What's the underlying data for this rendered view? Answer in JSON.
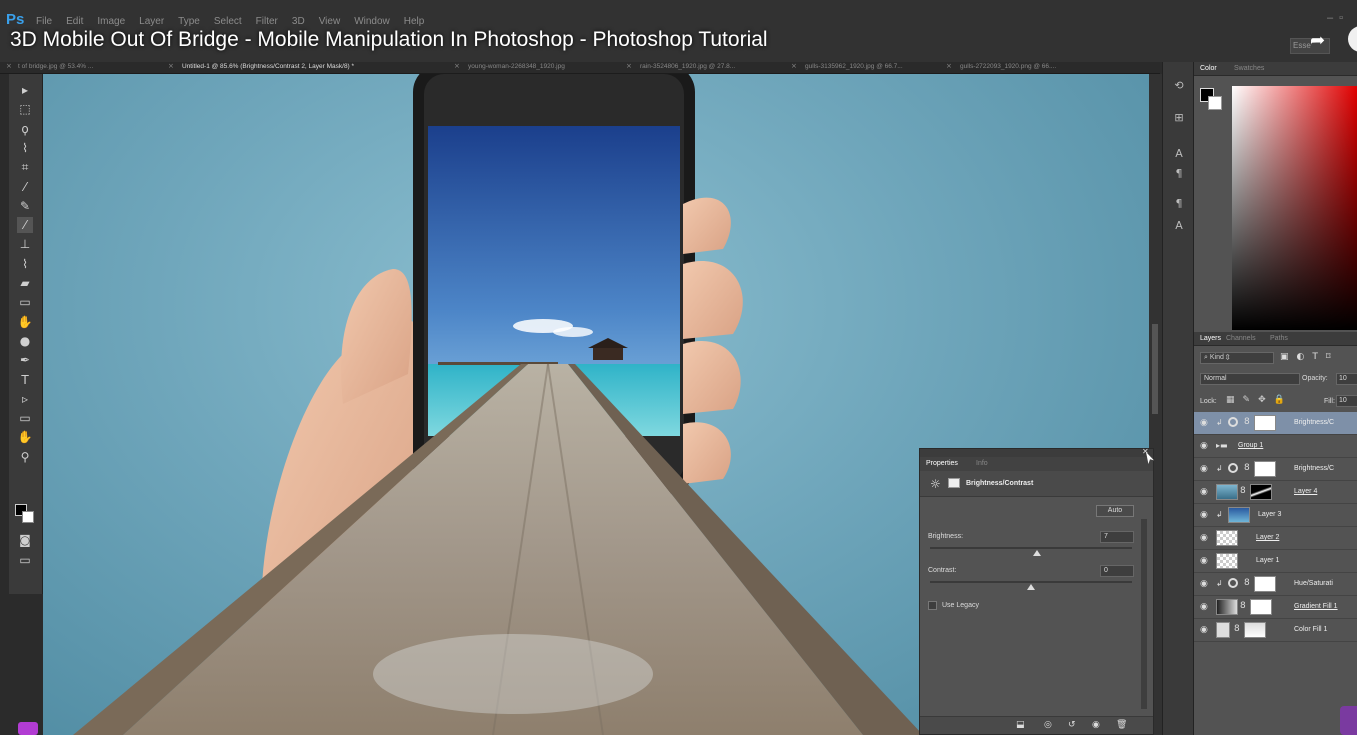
{
  "app": {
    "logo": "Ps"
  },
  "menu": [
    "File",
    "Edit",
    "Image",
    "Layer",
    "Type",
    "Select",
    "Filter",
    "3D",
    "View",
    "Window",
    "Help"
  ],
  "video_title": "3D Mobile Out Of Bridge - Mobile Manipulation In Photoshop - Photoshop Tutorial",
  "workspace": "Esse",
  "tabs": [
    {
      "label": "t of bridge.jpg @ 53.4% ...",
      "active": false
    },
    {
      "label": "Untitled-1 @ 85.6% (Brightness/Contrast 2, Layer Mask/8) *",
      "active": true
    },
    {
      "label": "young-woman-2268348_1920.jpg",
      "active": false
    },
    {
      "label": "rain-3524806_1920.jpg @ 27.8...",
      "active": false
    },
    {
      "label": "gulls-3135962_1920.jpg @ 66.7...",
      "active": false
    },
    {
      "label": "gulls-2722093_1920.png @ 66....",
      "active": false
    }
  ],
  "tools": [
    "move-icon",
    "marquee-icon",
    "lasso-icon",
    "quick-select-icon",
    "crop-icon",
    "eyedropper-icon",
    "healing-icon",
    "brush-icon",
    "stamp-icon",
    "history-brush-icon",
    "eraser-icon",
    "gradient-icon",
    "blur-icon",
    "dodge-icon",
    "pen-icon",
    "type-icon",
    "path-select-icon",
    "shape-icon",
    "hand-icon",
    "zoom-icon"
  ],
  "tool_glyphs": [
    "▸",
    "⬚",
    "ϙ",
    "⌇",
    "⌗",
    "⁄",
    "✎",
    "⁄",
    "⊥",
    "⌇",
    "▰",
    "▭",
    "✋",
    "●",
    "✒",
    "T",
    "▹",
    "▭",
    "✋",
    "⚲"
  ],
  "color_panel": {
    "tabs": [
      "Color",
      "Swatches"
    ],
    "accent": "#e00000"
  },
  "layers_panel": {
    "tabs": [
      "Layers",
      "Channels",
      "Paths"
    ],
    "kind": "Kind",
    "blend_mode": "Normal",
    "opacity_label": "Opacity:",
    "opacity": "10",
    "lock_label": "Lock:",
    "fill_label": "Fill:",
    "fill": "10",
    "layers": [
      {
        "name": "Brightness/C",
        "type": "adjustment",
        "selected": true,
        "clipped": true,
        "underline": false
      },
      {
        "name": "Group 1",
        "type": "group",
        "selected": false,
        "clipped": false,
        "underline": true
      },
      {
        "name": "Brightness/C",
        "type": "adjustment",
        "selected": false,
        "clipped": true,
        "underline": false
      },
      {
        "name": "Layer 4",
        "type": "masked",
        "selected": false,
        "clipped": false,
        "underline": true
      },
      {
        "name": "Layer 3",
        "type": "image",
        "selected": false,
        "clipped": true,
        "underline": false
      },
      {
        "name": "Layer 2",
        "type": "checker",
        "selected": false,
        "clipped": false,
        "underline": true
      },
      {
        "name": "Layer 1",
        "type": "checker",
        "selected": false,
        "clipped": false,
        "underline": false
      },
      {
        "name": "Hue/Saturati",
        "type": "adjustment",
        "selected": false,
        "clipped": true,
        "underline": false
      },
      {
        "name": "Gradient Fill 1",
        "type": "gradient",
        "selected": false,
        "clipped": false,
        "underline": true
      },
      {
        "name": "Color Fill 1",
        "type": "fill",
        "selected": false,
        "clipped": false,
        "underline": false
      }
    ]
  },
  "properties": {
    "tabs": [
      "Properties",
      "Info"
    ],
    "title": "Brightness/Contrast",
    "auto_label": "Auto",
    "brightness_label": "Brightness:",
    "brightness": "7",
    "brightness_pct": 0.53,
    "contrast_label": "Contrast:",
    "contrast": "0",
    "contrast_pct": 0.5,
    "legacy_label": "Use Legacy"
  }
}
